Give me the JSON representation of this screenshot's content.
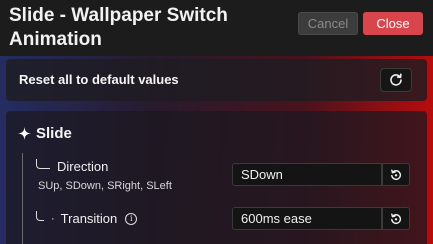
{
  "window": {
    "title": "Slide - Wallpaper Switch Animation",
    "cancel_label": "Cancel",
    "close_label": "Close"
  },
  "reset_panel": {
    "label": "Reset all to default values",
    "icon": "reset-icon"
  },
  "section": {
    "title": "Slide",
    "icon": "sparkle-icon",
    "rows": [
      {
        "label": "Direction",
        "hint": "SUp, SDown, SRight, SLeft",
        "value": "SDown",
        "reset_icon": "reset-value-icon"
      },
      {
        "label": "Transition",
        "info_icon": "info-icon",
        "value": "600ms ease",
        "reset_icon": "reset-value-icon"
      }
    ]
  },
  "colors": {
    "close_button": "#d9454c",
    "gradient_left": "#283c96",
    "gradient_right": "#d20a0a"
  }
}
